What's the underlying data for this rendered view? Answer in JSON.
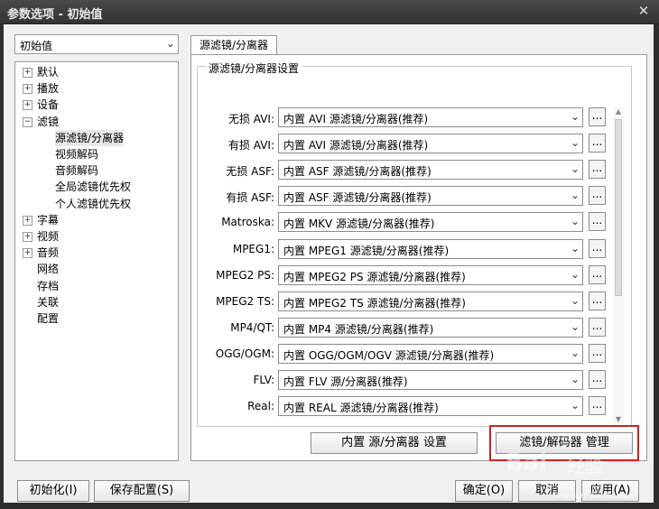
{
  "window": {
    "title": "参数选项 - 初始值",
    "close_glyph": "✕"
  },
  "preset": {
    "value": "初始值"
  },
  "tree": [
    {
      "label": "默认",
      "expandable": true,
      "glyph": "+"
    },
    {
      "label": "播放",
      "expandable": true,
      "glyph": "+"
    },
    {
      "label": "设备",
      "expandable": true,
      "glyph": "+"
    },
    {
      "label": "滤镜",
      "expandable": true,
      "glyph": "−"
    },
    {
      "label": "源滤镜/分离器",
      "selected": true
    },
    {
      "label": "视频解码"
    },
    {
      "label": "音频解码"
    },
    {
      "label": "全局滤镜优先权"
    },
    {
      "label": "个人滤镜优先权"
    },
    {
      "label": "字幕",
      "expandable": true,
      "glyph": "+"
    },
    {
      "label": "视频",
      "expandable": true,
      "glyph": "+"
    },
    {
      "label": "音频",
      "expandable": true,
      "glyph": "+"
    },
    {
      "label": "网络"
    },
    {
      "label": "存档"
    },
    {
      "label": "关联"
    },
    {
      "label": "配置"
    }
  ],
  "tab": {
    "label": "源滤镜/分离器"
  },
  "group": {
    "title": "源滤镜/分离器设置"
  },
  "rows": [
    {
      "label": "无损 AVI:",
      "value": "内置 AVI 源滤镜/分离器(推荐)"
    },
    {
      "label": "有损 AVI:",
      "value": "内置 AVI 源滤镜/分离器(推荐)"
    },
    {
      "label": "无损 ASF:",
      "value": "内置 ASF 源滤镜/分离器(推荐)"
    },
    {
      "label": "有损 ASF:",
      "value": "内置 ASF 源滤镜/分离器(推荐)"
    },
    {
      "label": "Matroska:",
      "value": "内置 MKV 源滤镜/分离器(推荐)"
    },
    {
      "label": "MPEG1:",
      "value": "内置 MPEG1 源滤镜/分离器(推荐)"
    },
    {
      "label": "MPEG2 PS:",
      "value": "内置 MPEG2 PS 源滤镜/分离器(推荐)"
    },
    {
      "label": "MPEG2 TS:",
      "value": "内置 MPEG2 TS 源滤镜/分离器(推荐)"
    },
    {
      "label": "MP4/QT:",
      "value": "内置 MP4 源滤镜/分离器(推荐)"
    },
    {
      "label": "OGG/OGM:",
      "value": "内置 OGG/OGM/OGV 源滤镜/分离器(推荐)"
    },
    {
      "label": "FLV:",
      "value": "内置 FLV 源/分离器(推荐)"
    },
    {
      "label": "Real:",
      "value": "内置 REAL 源滤镜/分离器(推荐)"
    }
  ],
  "more_glyph": "...",
  "panel_buttons": {
    "builtin_splitter": "内置 源/分离器 设置",
    "filter_manager": "滤镜/解码器 管理"
  },
  "footer": {
    "init": "初始化(I)",
    "save": "保存配置(S)",
    "ok": "确定(O)",
    "cancel": "取消",
    "apply": "应用(A)"
  },
  "watermark": {
    "brand": "Bai",
    "text": "经验",
    "suffix": "jingyan.baidu.com"
  },
  "colors": {
    "highlight": "#d02020",
    "titlebar": "#333333"
  }
}
